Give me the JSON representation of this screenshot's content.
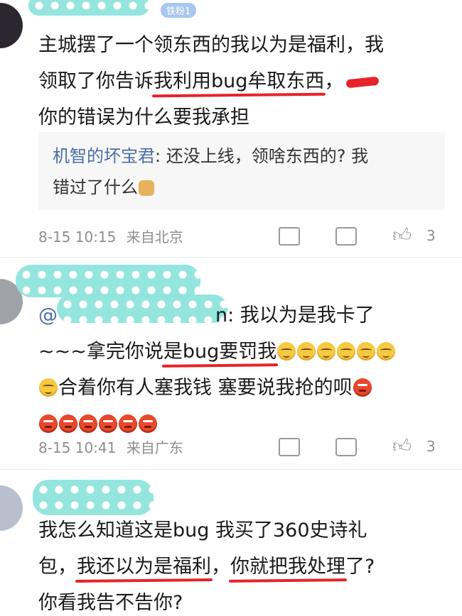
{
  "comments": [
    {
      "badge": "铁粉1",
      "body_lines": [
        [
          "主城摆了一个领东西的我以为是福利，我"
        ],
        [
          "领取了你告诉",
          "我利用bug牟取东西",
          "，"
        ],
        [
          "你的错误为什么要我承担"
        ]
      ],
      "reply": {
        "name": "机智的坏宝君",
        "text_line1": ": 还没上线，领啥东西的? 我",
        "text_line2": "错过了什么"
      },
      "time": "8-15 10:15",
      "source": "来自北京",
      "likes": "3"
    },
    {
      "username_visible": "@",
      "username_tail": "n: 我以为是我卡了",
      "body_lines": [
        [
          "~~~拿完你说",
          "是bug要罚我"
        ],
        [
          "合着你有人塞我钱  塞要说我抢的呗"
        ]
      ],
      "time": "8-15 10:41",
      "source": "来自广东",
      "likes": "3"
    },
    {
      "body_lines": [
        [
          "我怎么知道这是bug 我买了360史诗礼"
        ],
        [
          "包，",
          "我还以为是福利",
          "，",
          "你就把我处理",
          "了?"
        ],
        [
          "你看我告不告你?"
        ]
      ]
    }
  ],
  "icons": {
    "share": "share-icon",
    "comment": "comment-icon",
    "like": "thumbs-up-icon"
  },
  "colors": {
    "underline": "#e8222a",
    "reply_name": "#4a6fa5",
    "meta": "#8e8e8e",
    "redaction": "#8fe4dd"
  }
}
